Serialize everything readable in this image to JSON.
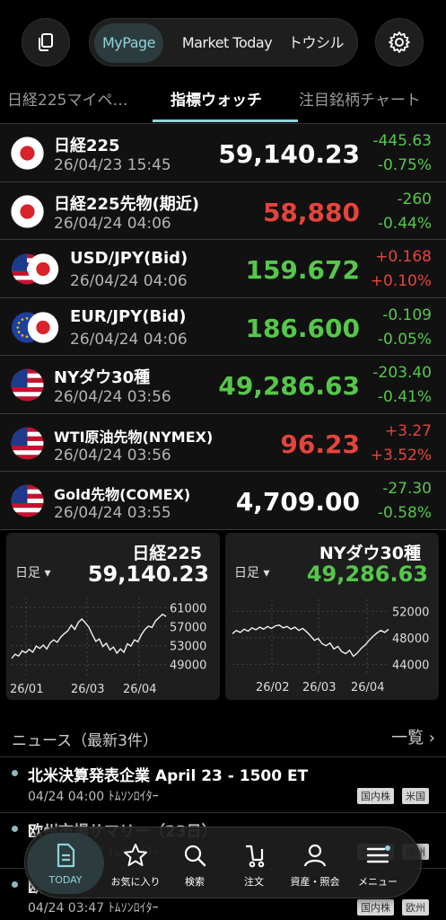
{
  "header": {
    "segments": [
      "MyPage",
      "Market Today",
      "トウシル"
    ],
    "active_segment": "MyPage"
  },
  "tabs": [
    "日経225マイペ…",
    "指標ウォッチ",
    "注目銘柄チャート"
  ],
  "active_tab": "指標ウォッチ",
  "watchlist": [
    {
      "name": "日経225",
      "time": "26/04/23 15:45",
      "price": "59,140.23",
      "change": "-445.63",
      "pct": "-0.75%",
      "price_dir": "flat",
      "chg_dir": "down",
      "flag": "jp-flag-icon"
    },
    {
      "name": "日経225先物(期近)",
      "time": "26/04/24 04:06",
      "price": "58,880",
      "change": "-260",
      "pct": "-0.44%",
      "price_dir": "up",
      "chg_dir": "down",
      "flag": "jp-flag-icon"
    },
    {
      "name": "USD/JPY(Bid)",
      "time": "26/04/24 04:06",
      "price": "159.672",
      "change": "+0.168",
      "pct": "+0.10%",
      "price_dir": "down",
      "chg_dir": "up",
      "flag": "us-jp-flag-icon"
    },
    {
      "name": "EUR/JPY(Bid)",
      "time": "26/04/24 04:06",
      "price": "186.600",
      "change": "-0.109",
      "pct": "-0.05%",
      "price_dir": "down",
      "chg_dir": "down",
      "flag": "eu-jp-flag-icon"
    },
    {
      "name": "NYダウ30種",
      "time": "26/04/24 03:56",
      "price": "49,286.63",
      "change": "-203.40",
      "pct": "-0.41%",
      "price_dir": "down",
      "chg_dir": "down",
      "flag": "us-flag-icon"
    },
    {
      "name": "WTI原油先物(NYMEX)",
      "time": "26/04/24 03:56",
      "price": "96.23",
      "change": "+3.27",
      "pct": "+3.52%",
      "price_dir": "up",
      "chg_dir": "up",
      "flag": "us-flag-icon"
    },
    {
      "name": "Gold先物(COMEX)",
      "time": "26/04/24 03:55",
      "price": "4,709.00",
      "change": "-27.30",
      "pct": "-0.58%",
      "price_dir": "flat",
      "chg_dir": "down",
      "flag": "us-flag-icon"
    }
  ],
  "mini_charts": [
    {
      "title": "日経225",
      "period": "日足",
      "price": "59,140.23",
      "price_color": "#ffffff",
      "y_ticks": [
        "61000",
        "57000",
        "53000",
        "49000"
      ],
      "x_ticks": [
        "26/01",
        "26/03",
        "26/04"
      ]
    },
    {
      "title": "NYダウ30種",
      "period": "日足",
      "price": "49,286.63",
      "price_color": "#56c74b",
      "y_ticks": [
        "52000",
        "48000",
        "44000"
      ],
      "x_ticks": [
        "26/02",
        "26/03",
        "26/04"
      ]
    }
  ],
  "chart_data": [
    {
      "type": "line",
      "title": "日経225",
      "ylim": [
        48000,
        62000
      ],
      "values": [
        50300,
        51200,
        50800,
        51900,
        51500,
        52200,
        51600,
        52900,
        52400,
        53100,
        52300,
        53600,
        54200,
        53700,
        54800,
        55500,
        56100,
        57300,
        56400,
        57900,
        58600,
        57800,
        56900,
        55300,
        53900,
        54400,
        52800,
        53500,
        52100,
        52700,
        51400,
        52300,
        51600,
        53400,
        52900,
        54200,
        53800,
        55300,
        56400,
        57100,
        56800,
        58200,
        58900,
        59600,
        59140
      ]
    },
    {
      "type": "line",
      "title": "NYダウ30種",
      "ylim": [
        43500,
        53000
      ],
      "values": [
        48600,
        49100,
        48800,
        49300,
        49000,
        49500,
        49200,
        49600,
        49300,
        49700,
        49400,
        49800,
        49900,
        49500,
        49700,
        49300,
        49600,
        49100,
        49400,
        48900,
        48300,
        47600,
        47900,
        47100,
        46800,
        47200,
        46300,
        46700,
        45900,
        45600,
        46100,
        45200,
        45700,
        46400,
        46900,
        47600,
        48200,
        48700,
        49100,
        48800,
        49286
      ]
    }
  ],
  "news": {
    "title": "ニュース（最新3件）",
    "more_label": "一覧 ›",
    "items": [
      {
        "headline": "北米決算発表企業 April 23 - 1500 ET",
        "meta": "04/24 04:00 ﾄﾑｿﾝﾛｲﾀｰ",
        "tags": [
          "国内株",
          "米国"
        ]
      },
      {
        "headline": "欧州市場サマリー（23日）",
        "meta": "04/24 03:47 ﾄﾑｿﾝﾛｲﾀｰ",
        "tags": [
          "国内株",
          "欧州"
        ]
      },
      {
        "headline": "欧",
        "meta": "04/24 03:47 ﾄﾑｿﾝﾛｲﾀｰ",
        "tags": [
          "国内株",
          "欧州"
        ]
      }
    ]
  },
  "bottom_nav": [
    {
      "label": "TODAY",
      "icon": "today-doc-icon"
    },
    {
      "label": "お気に入り",
      "icon": "star-icon"
    },
    {
      "label": "検索",
      "icon": "search-icon"
    },
    {
      "label": "注文",
      "icon": "cart-icon"
    },
    {
      "label": "資産・照会",
      "icon": "person-icon"
    },
    {
      "label": "メニュー",
      "icon": "menu-icon"
    }
  ],
  "colors": {
    "accent": "#8fd3dc",
    "up": "#e5443c",
    "down": "#56c74b"
  }
}
